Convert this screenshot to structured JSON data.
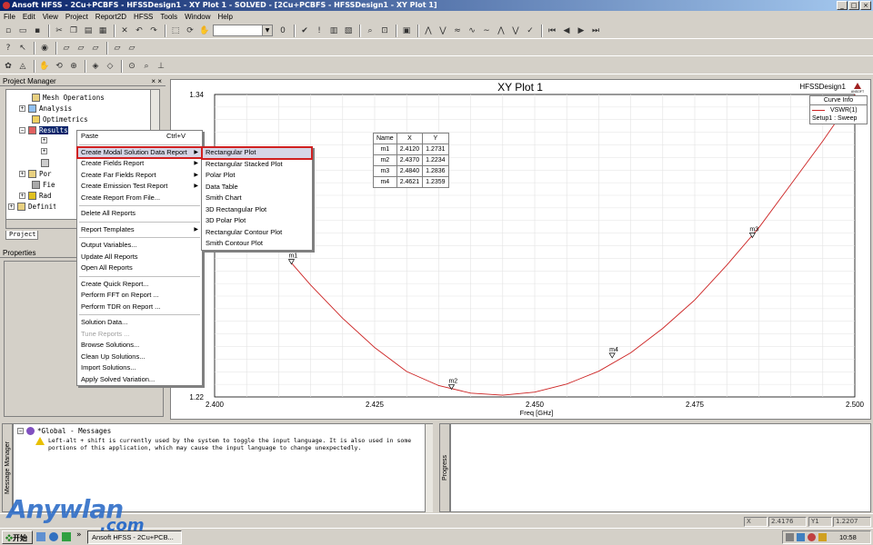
{
  "window": {
    "title": "Ansoft HFSS - 2Cu+PCBFS - HFSSDesign1 - XY Plot 1 - SOLVED - [2Cu+PCBFS - HFSSDesign1 - XY Plot 1]",
    "buttons": [
      "_",
      "□",
      "×"
    ]
  },
  "menu": [
    "File",
    "Edit",
    "View",
    "Project",
    "Report2D",
    "HFSS",
    "Tools",
    "Window",
    "Help"
  ],
  "project_manager": {
    "title": "Project Manager",
    "controls": "× ×",
    "items": [
      {
        "label": "Mesh Operations"
      },
      {
        "label": "Analysis"
      },
      {
        "label": "Optimetrics"
      },
      {
        "label": "Results"
      },
      {
        "label": "Port Field Display"
      },
      {
        "label": "Field Overlays"
      },
      {
        "label": "Radiation"
      },
      {
        "label": "Definitions"
      }
    ],
    "tab": "Project"
  },
  "properties": {
    "title": "Properties"
  },
  "context_menu": {
    "items": [
      {
        "label": "Paste",
        "shortcut": "Ctrl+V"
      },
      {
        "label": "Create Modal Solution Data Report",
        "submenu": "▶"
      },
      {
        "label": "Create Fields Report",
        "submenu": "▶"
      },
      {
        "label": "Create Far Fields Report",
        "submenu": "▶"
      },
      {
        "label": "Create Emission Test Report",
        "submenu": "▶"
      },
      {
        "label": "Create Report From File..."
      },
      {
        "label": "Delete All Reports"
      },
      {
        "label": "Report Templates",
        "submenu": "▶"
      },
      {
        "label": "Output Variables..."
      },
      {
        "label": "Update All Reports"
      },
      {
        "label": "Open All Reports"
      },
      {
        "label": "Create Quick Report..."
      },
      {
        "label": "Perform FFT on Report ..."
      },
      {
        "label": "Perform TDR on Report ..."
      },
      {
        "label": "Solution Data..."
      },
      {
        "label": "Tune Reports ..."
      },
      {
        "label": "Browse Solutions..."
      },
      {
        "label": "Clean Up Solutions..."
      },
      {
        "label": "Import Solutions..."
      },
      {
        "label": "Apply Solved Variation..."
      }
    ]
  },
  "submenu": {
    "items": [
      {
        "label": "Rectangular Plot"
      },
      {
        "label": "Rectangular Stacked Plot"
      },
      {
        "label": "Polar Plot"
      },
      {
        "label": "Data Table"
      },
      {
        "label": "Smith Chart"
      },
      {
        "label": "3D Rectangular Plot"
      },
      {
        "label": "3D Polar Plot"
      },
      {
        "label": "Rectangular Contour Plot"
      },
      {
        "label": "Smith Contour Plot"
      }
    ]
  },
  "plot": {
    "design": "HFSSDesign1",
    "logo_text": "ANSOFT",
    "curve_info": {
      "title": "Curve Info",
      "trace": "VSWR(1)",
      "setup": "Setup1 : Sweep"
    },
    "marker_table": {
      "headers": [
        "Name",
        "X",
        "Y"
      ],
      "rows": [
        [
          "m1",
          "2.4120",
          "1.2731"
        ],
        [
          "m2",
          "2.4370",
          "1.2234"
        ],
        [
          "m3",
          "2.4840",
          "1.2836"
        ],
        [
          "m4",
          "2.4621",
          "1.2359"
        ]
      ]
    }
  },
  "chart_data": {
    "type": "line",
    "title": "XY Plot 1",
    "xlabel": "Freq [GHz]",
    "ylabel": "",
    "xlim": [
      2.4,
      2.5
    ],
    "ylim": [
      1.22,
      1.34
    ],
    "xticks": [
      "2.400",
      "2.425",
      "2.450",
      "2.475",
      "2.500"
    ],
    "yticks": [
      "1.34",
      "1.22"
    ],
    "grid": true,
    "series": [
      {
        "name": "VSWR(1)",
        "color": "#cc2222",
        "x": [
          2.412,
          2.415,
          2.42,
          2.425,
          2.43,
          2.435,
          2.44,
          2.445,
          2.45,
          2.455,
          2.46,
          2.465,
          2.47,
          2.475,
          2.48,
          2.485,
          2.49,
          2.495,
          2.5
        ],
        "y": [
          1.2731,
          1.2644,
          1.2512,
          1.2396,
          1.2301,
          1.2245,
          1.2215,
          1.2207,
          1.2219,
          1.2251,
          1.2302,
          1.2375,
          1.2472,
          1.2585,
          1.2723,
          1.2871,
          1.3043,
          1.3215,
          1.3399
        ]
      }
    ],
    "markers": [
      {
        "name": "m1",
        "x": 2.412,
        "y": 1.2731
      },
      {
        "name": "m2",
        "x": 2.437,
        "y": 1.2234
      },
      {
        "name": "m3",
        "x": 2.484,
        "y": 1.2836
      },
      {
        "name": "m4",
        "x": 2.4621,
        "y": 1.2359
      }
    ]
  },
  "messages": {
    "title": "*Global - Messages",
    "text": "Left-alt + shift is currently used by the system to toggle the input language. It is also used in some portions of this application, which may cause the input language to change unexpectedly.",
    "tab_left": "Message Manager",
    "tab_right": "Progress"
  },
  "statusbar": {
    "x_label": "X",
    "x_value": "2.4176",
    "y_label": "Y1",
    "y_value": "1.2207"
  },
  "taskbar": {
    "start": "开始",
    "items": [
      "Ansoft HFSS - 2Cu+PCB..."
    ],
    "clock": "10:58"
  },
  "watermark": {
    "line1": "Anywlan",
    "line2": ".com"
  }
}
